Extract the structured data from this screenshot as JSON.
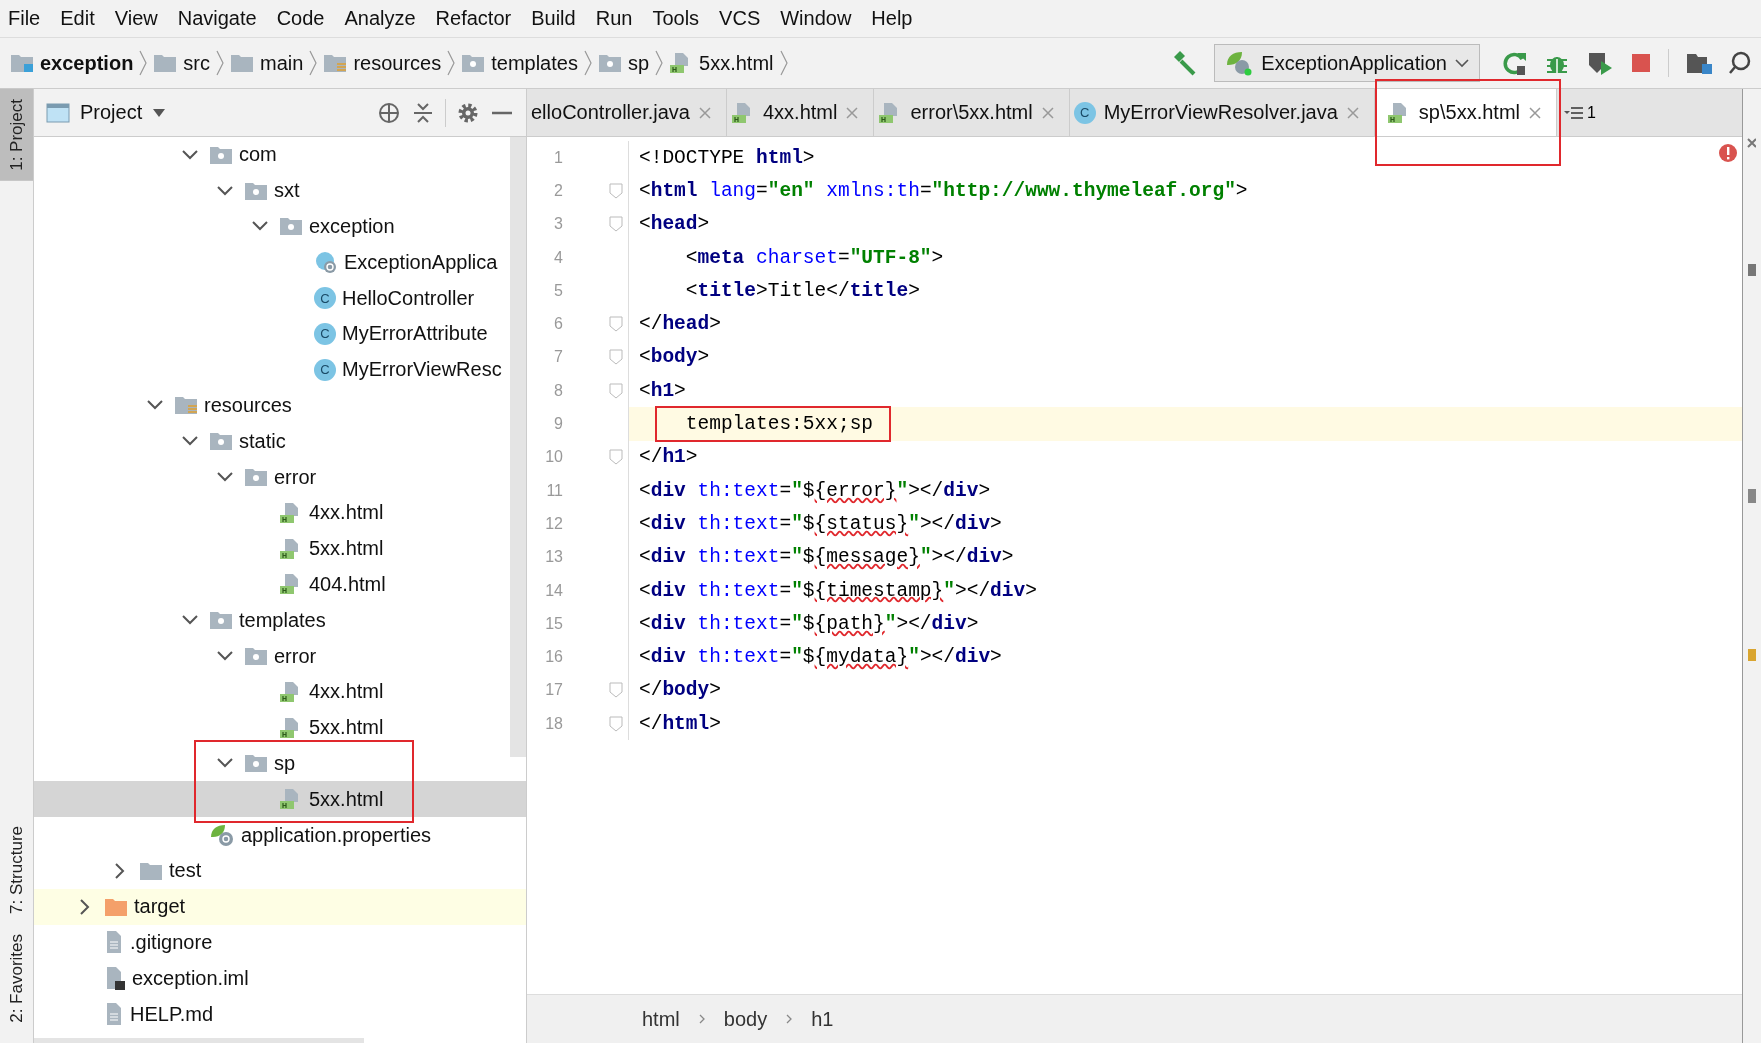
{
  "menu": [
    {
      "label": "File"
    },
    {
      "label": "Edit"
    },
    {
      "label": "View"
    },
    {
      "label": "Navigate"
    },
    {
      "label": "Code"
    },
    {
      "label": "Analyze"
    },
    {
      "label": "Refactor"
    },
    {
      "label": "Build"
    },
    {
      "label": "Run"
    },
    {
      "label": "Tools"
    },
    {
      "label": "VCS"
    },
    {
      "label": "Window"
    },
    {
      "label": "Help"
    }
  ],
  "breadcrumbs": [
    {
      "label": "exception",
      "kind": "module"
    },
    {
      "label": "src",
      "kind": "folder"
    },
    {
      "label": "main",
      "kind": "folder"
    },
    {
      "label": "resources",
      "kind": "resources"
    },
    {
      "label": "templates",
      "kind": "package"
    },
    {
      "label": "sp",
      "kind": "package"
    },
    {
      "label": "5xx.html",
      "kind": "html"
    }
  ],
  "run_config": {
    "label": "ExceptionApplication"
  },
  "left_stripe": [
    {
      "label": "1: Project",
      "selected": true
    },
    {
      "label": "7: Structure",
      "selected": false
    },
    {
      "label": "2: Favorites",
      "selected": false
    }
  ],
  "project_panel": {
    "title": "Project"
  },
  "tree": {
    "items": [
      {
        "children": [
          {
            "children": [
              {
                "children": [
                  {
                    "label": "com",
                    "kind": "package",
                    "expanded": true,
                    "selected": false,
                    "excluded": false,
                    "children": [
                      {
                        "label": "sxt",
                        "kind": "package",
                        "expanded": true,
                        "selected": false,
                        "excluded": false,
                        "children": [
                          {
                            "label": "exception",
                            "kind": "package",
                            "expanded": true,
                            "selected": false,
                            "excluded": false,
                            "children": [
                              {
                                "label": "ExceptionApplica",
                                "kind": "spring-class",
                                "selected": false,
                                "excluded": false
                              },
                              {
                                "label": "HelloController",
                                "kind": "class",
                                "letter": "C",
                                "selected": false,
                                "excluded": false
                              },
                              {
                                "label": "MyErrorAttribute",
                                "kind": "class",
                                "letter": "C",
                                "selected": false,
                                "excluded": false
                              },
                              {
                                "label": "MyErrorViewResc",
                                "kind": "class",
                                "letter": "C",
                                "selected": false,
                                "excluded": false
                              }
                            ]
                          }
                        ]
                      }
                    ]
                  }
                ]
              },
              {
                "label": "resources",
                "kind": "resources",
                "expanded": true,
                "selected": false,
                "excluded": false,
                "children": [
                  {
                    "label": "static",
                    "kind": "package",
                    "expanded": true,
                    "selected": false,
                    "excluded": false,
                    "children": [
                      {
                        "label": "error",
                        "kind": "package",
                        "expanded": true,
                        "selected": false,
                        "excluded": false,
                        "children": [
                          {
                            "label": "4xx.html",
                            "kind": "html",
                            "selected": false,
                            "excluded": false
                          },
                          {
                            "label": "5xx.html",
                            "kind": "html",
                            "selected": false,
                            "excluded": false
                          },
                          {
                            "label": "404.html",
                            "kind": "html",
                            "selected": false,
                            "excluded": false
                          }
                        ]
                      }
                    ]
                  },
                  {
                    "label": "templates",
                    "kind": "package",
                    "expanded": true,
                    "selected": false,
                    "excluded": false,
                    "children": [
                      {
                        "label": "error",
                        "kind": "package",
                        "expanded": true,
                        "selected": false,
                        "excluded": false,
                        "children": [
                          {
                            "label": "4xx.html",
                            "kind": "html",
                            "selected": false,
                            "excluded": false
                          },
                          {
                            "label": "5xx.html",
                            "kind": "html",
                            "selected": false,
                            "excluded": false
                          }
                        ]
                      },
                      {
                        "label": "sp",
                        "kind": "package",
                        "expanded": true,
                        "selected": false,
                        "excluded": false,
                        "boxed": true,
                        "children": [
                          {
                            "label": "5xx.html",
                            "kind": "html",
                            "selected": true,
                            "excluded": false
                          }
                        ]
                      }
                    ]
                  },
                  {
                    "label": "application.properties",
                    "kind": "properties",
                    "selected": false,
                    "excluded": false
                  }
                ]
              }
            ]
          },
          {
            "label": "test",
            "kind": "folder",
            "expanded": false,
            "selected": false,
            "excluded": false
          }
        ]
      },
      {
        "label": "target",
        "kind": "target",
        "expanded": false,
        "selected": false,
        "excluded": true
      },
      {
        "label": ".gitignore",
        "kind": "text",
        "selected": false,
        "excluded": false
      },
      {
        "label": "exception.iml",
        "kind": "iml",
        "selected": false,
        "excluded": false
      },
      {
        "label": "HELP.md",
        "kind": "text",
        "selected": false,
        "excluded": false
      }
    ]
  },
  "tabs": [
    {
      "label": "elloController.java",
      "kind": "none",
      "selected": false
    },
    {
      "label": "4xx.html",
      "kind": "html",
      "selected": false
    },
    {
      "label": "error\\5xx.html",
      "kind": "html",
      "selected": false
    },
    {
      "label": "MyErrorViewResolver.java",
      "kind": "class",
      "letter": "C",
      "selected": false
    },
    {
      "label": "sp\\5xx.html",
      "kind": "html",
      "selected": true,
      "boxed": true
    }
  ],
  "tab_overflow_count": "1",
  "code": {
    "lines": [
      {
        "number": "1",
        "fold": false,
        "current": false,
        "segments": [
          {
            "text": "<!DOCTYPE ",
            "kind": "text"
          },
          {
            "text": "html",
            "kind": "tag"
          },
          {
            "text": ">",
            "kind": "punct"
          }
        ]
      },
      {
        "number": "2",
        "fold": true,
        "current": false,
        "segments": [
          {
            "text": "<",
            "kind": "punct"
          },
          {
            "text": "html",
            "kind": "tag"
          },
          {
            "text": " lang",
            "kind": "attr"
          },
          {
            "text": "=",
            "kind": "punct"
          },
          {
            "text": "\"en\"",
            "kind": "value"
          },
          {
            "text": " xmlns:th",
            "kind": "attr"
          },
          {
            "text": "=",
            "kind": "punct"
          },
          {
            "text": "\"http://www.thymeleaf.org\"",
            "kind": "value"
          },
          {
            "text": ">",
            "kind": "punct"
          }
        ]
      },
      {
        "number": "3",
        "fold": true,
        "current": false,
        "segments": [
          {
            "text": "<",
            "kind": "punct"
          },
          {
            "text": "head",
            "kind": "tag"
          },
          {
            "text": ">",
            "kind": "punct"
          }
        ]
      },
      {
        "number": "4",
        "fold": false,
        "current": false,
        "segments": [
          {
            "text": "    <",
            "kind": "punct"
          },
          {
            "text": "meta",
            "kind": "tag"
          },
          {
            "text": " charset",
            "kind": "attr"
          },
          {
            "text": "=",
            "kind": "punct"
          },
          {
            "text": "\"UTF-8\"",
            "kind": "value"
          },
          {
            "text": ">",
            "kind": "punct"
          }
        ]
      },
      {
        "number": "5",
        "fold": false,
        "current": false,
        "segments": [
          {
            "text": "    <",
            "kind": "punct"
          },
          {
            "text": "title",
            "kind": "tag"
          },
          {
            "text": ">",
            "kind": "punct"
          },
          {
            "text": "Title",
            "kind": "text"
          },
          {
            "text": "</",
            "kind": "punct"
          },
          {
            "text": "title",
            "kind": "tag"
          },
          {
            "text": ">",
            "kind": "punct"
          }
        ]
      },
      {
        "number": "6",
        "fold": true,
        "current": false,
        "segments": [
          {
            "text": "</",
            "kind": "punct"
          },
          {
            "text": "head",
            "kind": "tag"
          },
          {
            "text": ">",
            "kind": "punct"
          }
        ]
      },
      {
        "number": "7",
        "fold": true,
        "current": false,
        "segments": [
          {
            "text": "<",
            "kind": "punct"
          },
          {
            "text": "body",
            "kind": "tag"
          },
          {
            "text": ">",
            "kind": "punct"
          }
        ]
      },
      {
        "number": "8",
        "fold": true,
        "current": false,
        "segments": [
          {
            "text": "<",
            "kind": "punct"
          },
          {
            "text": "h1",
            "kind": "tag"
          },
          {
            "text": ">",
            "kind": "punct"
          }
        ]
      },
      {
        "number": "9",
        "fold": false,
        "current": true,
        "boxed": true,
        "segments": [
          {
            "text": "    templates:5xx;sp",
            "kind": "text"
          }
        ]
      },
      {
        "number": "10",
        "fold": true,
        "current": false,
        "segments": [
          {
            "text": "</",
            "kind": "punct"
          },
          {
            "text": "h1",
            "kind": "tag"
          },
          {
            "text": ">",
            "kind": "punct"
          }
        ]
      },
      {
        "number": "11",
        "fold": false,
        "current": false,
        "segments": [
          {
            "text": "<",
            "kind": "punct"
          },
          {
            "text": "div",
            "kind": "tag"
          },
          {
            "text": " th:text",
            "kind": "attr"
          },
          {
            "text": "=",
            "kind": "punct"
          },
          {
            "text": "\"",
            "kind": "value"
          },
          {
            "text": "$",
            "kind": "expr"
          },
          {
            "text": "{error}",
            "kind": "typo"
          },
          {
            "text": "\"",
            "kind": "value"
          },
          {
            "text": "></",
            "kind": "punct"
          },
          {
            "text": "div",
            "kind": "tag"
          },
          {
            "text": ">",
            "kind": "punct"
          }
        ]
      },
      {
        "number": "12",
        "fold": false,
        "current": false,
        "segments": [
          {
            "text": "<",
            "kind": "punct"
          },
          {
            "text": "div",
            "kind": "tag"
          },
          {
            "text": " th:text",
            "kind": "attr"
          },
          {
            "text": "=",
            "kind": "punct"
          },
          {
            "text": "\"",
            "kind": "value"
          },
          {
            "text": "$",
            "kind": "expr"
          },
          {
            "text": "{status}",
            "kind": "typo"
          },
          {
            "text": "\"",
            "kind": "value"
          },
          {
            "text": "></",
            "kind": "punct"
          },
          {
            "text": "div",
            "kind": "tag"
          },
          {
            "text": ">",
            "kind": "punct"
          }
        ]
      },
      {
        "number": "13",
        "fold": false,
        "current": false,
        "segments": [
          {
            "text": "<",
            "kind": "punct"
          },
          {
            "text": "div",
            "kind": "tag"
          },
          {
            "text": " th:text",
            "kind": "attr"
          },
          {
            "text": "=",
            "kind": "punct"
          },
          {
            "text": "\"",
            "kind": "value"
          },
          {
            "text": "$",
            "kind": "expr"
          },
          {
            "text": "{message}",
            "kind": "typo"
          },
          {
            "text": "\"",
            "kind": "value"
          },
          {
            "text": "></",
            "kind": "punct"
          },
          {
            "text": "div",
            "kind": "tag"
          },
          {
            "text": ">",
            "kind": "punct"
          }
        ]
      },
      {
        "number": "14",
        "fold": false,
        "current": false,
        "segments": [
          {
            "text": "<",
            "kind": "punct"
          },
          {
            "text": "div",
            "kind": "tag"
          },
          {
            "text": " th:text",
            "kind": "attr"
          },
          {
            "text": "=",
            "kind": "punct"
          },
          {
            "text": "\"",
            "kind": "value"
          },
          {
            "text": "$",
            "kind": "expr"
          },
          {
            "text": "{timestamp}",
            "kind": "typo"
          },
          {
            "text": "\"",
            "kind": "value"
          },
          {
            "text": "></",
            "kind": "punct"
          },
          {
            "text": "div",
            "kind": "tag"
          },
          {
            "text": ">",
            "kind": "punct"
          }
        ]
      },
      {
        "number": "15",
        "fold": false,
        "current": false,
        "segments": [
          {
            "text": "<",
            "kind": "punct"
          },
          {
            "text": "div",
            "kind": "tag"
          },
          {
            "text": " th:text",
            "kind": "attr"
          },
          {
            "text": "=",
            "kind": "punct"
          },
          {
            "text": "\"",
            "kind": "value"
          },
          {
            "text": "$",
            "kind": "expr"
          },
          {
            "text": "{path}",
            "kind": "typo"
          },
          {
            "text": "\"",
            "kind": "value"
          },
          {
            "text": "></",
            "kind": "punct"
          },
          {
            "text": "div",
            "kind": "tag"
          },
          {
            "text": ">",
            "kind": "punct"
          }
        ]
      },
      {
        "number": "16",
        "fold": false,
        "current": false,
        "segments": [
          {
            "text": "<",
            "kind": "punct"
          },
          {
            "text": "div",
            "kind": "tag"
          },
          {
            "text": " th:text",
            "kind": "attr"
          },
          {
            "text": "=",
            "kind": "punct"
          },
          {
            "text": "\"",
            "kind": "value"
          },
          {
            "text": "$",
            "kind": "expr"
          },
          {
            "text": "{mydata}",
            "kind": "typo"
          },
          {
            "text": "\"",
            "kind": "value"
          },
          {
            "text": "></",
            "kind": "punct"
          },
          {
            "text": "div",
            "kind": "tag"
          },
          {
            "text": ">",
            "kind": "punct"
          }
        ]
      },
      {
        "number": "17",
        "fold": true,
        "current": false,
        "segments": [
          {
            "text": "</",
            "kind": "punct"
          },
          {
            "text": "body",
            "kind": "tag"
          },
          {
            "text": ">",
            "kind": "punct"
          }
        ]
      },
      {
        "number": "18",
        "fold": true,
        "current": false,
        "segments": [
          {
            "text": "</",
            "kind": "punct"
          },
          {
            "text": "html",
            "kind": "tag"
          },
          {
            "text": ">",
            "kind": "punct"
          }
        ]
      }
    ]
  },
  "path_bar": [
    "html",
    "body",
    "h1"
  ]
}
